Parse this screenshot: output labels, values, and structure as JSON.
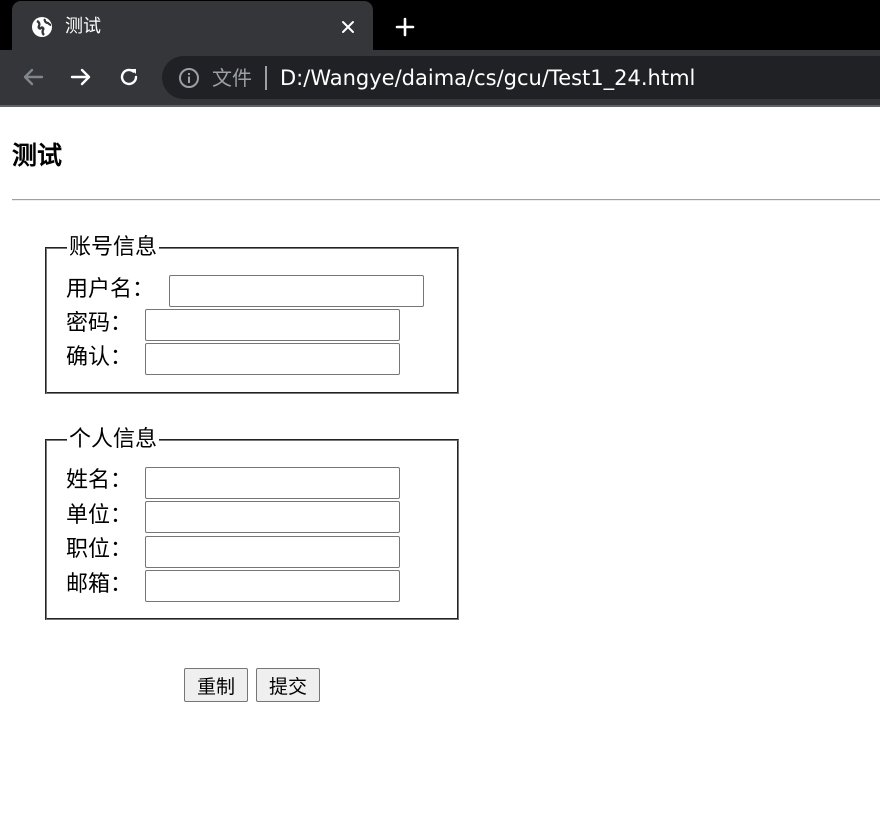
{
  "browser": {
    "tab_title": "测试",
    "address_scheme": "文件",
    "url": "D:/Wangye/daima/cs/gcu/Test1_24.html",
    "colors": {
      "tabstrip": "#000000",
      "toolbar": "#35363a",
      "omnibox": "#202124"
    }
  },
  "page": {
    "title": "测试"
  },
  "account_section": {
    "legend": "账号信息",
    "fields": [
      {
        "label": "用户名：",
        "value": ""
      },
      {
        "label": "密码：",
        "value": ""
      },
      {
        "label": "确认：",
        "value": ""
      }
    ]
  },
  "personal_section": {
    "legend": "个人信息",
    "fields": [
      {
        "label": "姓名：",
        "value": ""
      },
      {
        "label": "单位：",
        "value": ""
      },
      {
        "label": "职位：",
        "value": ""
      },
      {
        "label": "邮箱：",
        "value": ""
      }
    ]
  },
  "actions": {
    "reset_label": "重制",
    "submit_label": "提交"
  },
  "icons": {
    "tab": "globe-icon",
    "close": "close-icon",
    "new_tab": "plus-icon",
    "back": "arrow-left-icon",
    "forward": "arrow-right-icon",
    "reload": "reload-icon",
    "info": "info-icon"
  }
}
